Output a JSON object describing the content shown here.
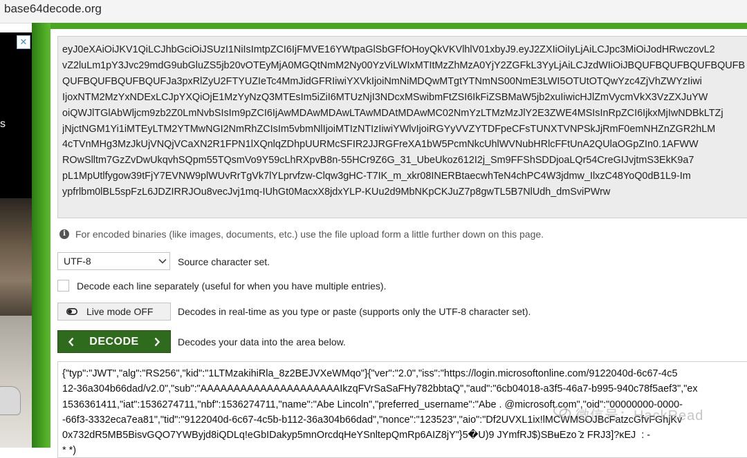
{
  "browser": {
    "url": "base64decode.org"
  },
  "ad": {
    "close_glyph": "✕",
    "side_text": "s"
  },
  "encoded": {
    "lines": [
      "eyJ0eXAiOiJKV1QiLCJhbGciOiJSUzI1NiIsImtpZCI6IjFMVE16YWtpaGlSbGFfOHoyQkVKVlhlV01xbyJ9.eyJ2ZXIiOiIyLjAiLCJpc3MiOiJodHRwczovL2",
      "vZ2luLm1pY3Jvc29mdG9ubGluZS5jb20vOTEyMjA0MGQtNmM2Ny00YzViLWIxMTItMzZhMzA0YjY2ZGFkL3YyLjAiLCJzdWIiOiJBQUFBQUFBQUFBQUFB",
      "QUFBQUFBQUFBQUFJa3pxRlZyU2FTYUZIeTc4MmJidGFRIiwiYXVkIjoiNmNiMDQwMTgtYTNmNS00NmE3LWI5OTUtOTQwYzc4ZjVhZWYzIiwi",
      "IjoxNTM2MzYxNDExLCJpYXQiOjE1MzYyNzQ3MTEsIm5iZiI6MTUzNjI3NDcxMSwibmFtZSI6IkFiZSBMaW5jb2xuIiwicHJlZmVycmVkX3VzZXJuYW",
      "oiQWJlTGlAbWljcm9zb2Z0LmNvbSIsIm9pZCI6IjAwMDAwMDAwLTAwMDAtMDAwMC02NmYzLTMzMzJlY2E3ZWE4MSIsInRpZCI6IjkxMjIwNDBkLTZj",
      "jNjctNGM1Yi1iMTEyLTM2YTMwNGI2NmRhZCIsIm5vbmNlIjoiMTIzNTIzIiwiYWlvIjoiRGYyVVZYTDFpeCFsTUNXTVNPSkJjRmF0emNHZnZGR2hLM",
      "4cTVnMHg3MzJkUjVNQjVCaXN2R1FPN1lXQnlqZDhpUURMcSFIR2JJRGFreXA1bW5PcmNkcUhlWVNubHRlcFFtUnA2QUlaOGpZIn0.1AFWW",
      "ROwSlltm7GzZvDwUkqvhSQpm55TQsmVo9Y59cLhRXpvB8n-55HCr9Z6G_31_UbeUkoz612I2j_Sm9FFShSDDjoaLQr54CreGIJvjtmS3EkK9a7",
      "pL1MpUtlfygow39tFjY7EVNW9plWUvRrTgVk7lYLprvfzw-Clqw3gHC-T7IK_m_xkr08INERBtaecwhTeN4chPC4W3jdmw_IlxzC48YoQ0dB1L9-Im",
      "ypfrlbm0lBL5spFzL6JDZIRRJOu8vecJvj1mq-IUhGt0MacxX8jdxYLP-KUu2d9MbNKpCKJuZ7p8gwTL5B7NlUdh_dmSviPWrw"
    ]
  },
  "info": {
    "icon_glyph": "i",
    "text": "For encoded binaries (like images, documents, etc.) use the file upload form a little further down on this page."
  },
  "charset": {
    "value": "UTF-8",
    "label": "Source character set."
  },
  "line_mode": {
    "label": "Decode each line separately (useful for when you have multiple entries)."
  },
  "live_mode": {
    "button_label": "Live mode OFF",
    "description": "Decodes in real-time as you type or paste (supports only the UTF-8 character set)."
  },
  "decode": {
    "button_label": "DECODE",
    "description": "Decodes your data into the area below."
  },
  "decoded": {
    "lines": [
      "{\"typ\":\"JWT\",\"alg\":\"RS256\",\"kid\":\"1LTMzakihiRla_8z2BEJVXeWMqo\"}{\"ver\":\"2.0\",\"iss\":\"https://login.microsoftonline.com/9122040d-6c67-4c5",
      "12-36a304b66dad/v2.0\",\"sub\":\"AAAAAAAAAAAAAAAAAAAAAIkzqFVrSaSaFHy782bbtaQ\",\"aud\":\"6cb04018-a3f5-46a7-b995-940c78f5aef3\",\"ex",
      "1536361411,\"iat\":1536274711,\"nbf\":1536274711,\"name\":\"Abe Lincoln\",\"preferred_username\":\"Abe . @microsoft.com\",\"oid\":\"00000000-0000-",
      "-66f3-3332eca7ea81\",\"tid\":\"9122040d-6c67-4c5b-b112-36a304b66dad\",\"nonce\":\"123523\",\"aio\":\"Df2UVXL1ix!lMCWMSOJBcFatzcGfvFGhjKv",
      "0x732dR5MB5BisvGQO7YWByjd8iQDLq!eGbIDakyp5mnOrcdqHeYSnltepQmRp6AIZ8jY\"}5�U)9 JYmfRJ$)SBʉEzo ̄z FRJ3]?κEJ  : -",
      "* *)"
    ]
  },
  "watermark": {
    "text": "微信号：HackRead"
  }
}
